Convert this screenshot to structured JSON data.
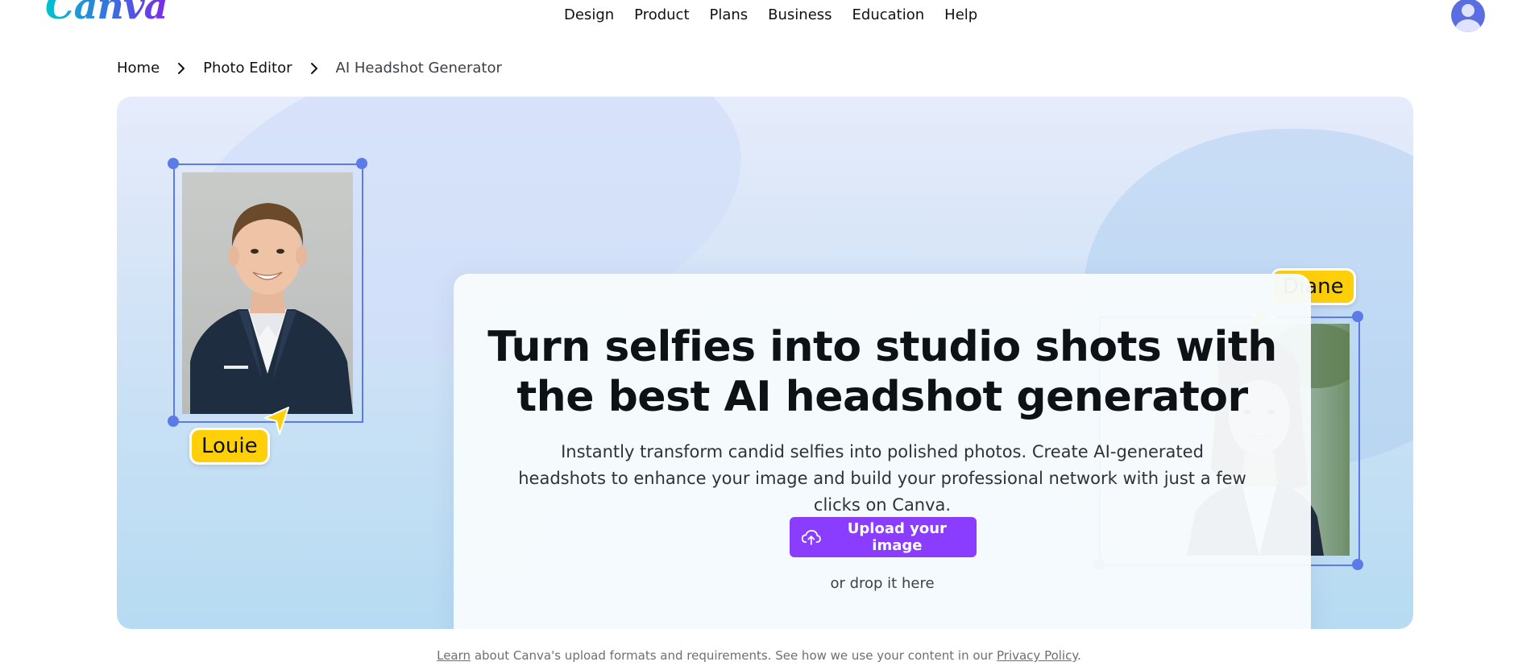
{
  "header": {
    "logo_text": "Canva",
    "nav": [
      "Design",
      "Product",
      "Plans",
      "Business",
      "Education",
      "Help"
    ]
  },
  "breadcrumb": {
    "items": [
      "Home",
      "Photo Editor",
      "AI Headshot Generator"
    ]
  },
  "hero": {
    "title": "Turn selfies into studio shots with the best AI headshot generator",
    "description": "Instantly transform candid selfies into polished photos. Create AI-generated headshots to enhance your image and build your professional network with just a few clicks on Canva.",
    "upload_button": "Upload your image",
    "drop_text": "or drop it here",
    "left_tag": "Louie",
    "right_tag": "Diane"
  },
  "footnote": {
    "learn": "Learn",
    "middle": " about Canva's upload formats and requirements. See how we use your content in our ",
    "privacy": "Privacy Policy",
    "end": "."
  },
  "colors": {
    "brand_purple": "#8b3dff",
    "frame_blue": "#5d7be8",
    "tag_yellow": "#ffcf0a"
  },
  "icons": [
    "chevron-right-icon",
    "upload-cloud-icon",
    "user-avatar-icon"
  ]
}
